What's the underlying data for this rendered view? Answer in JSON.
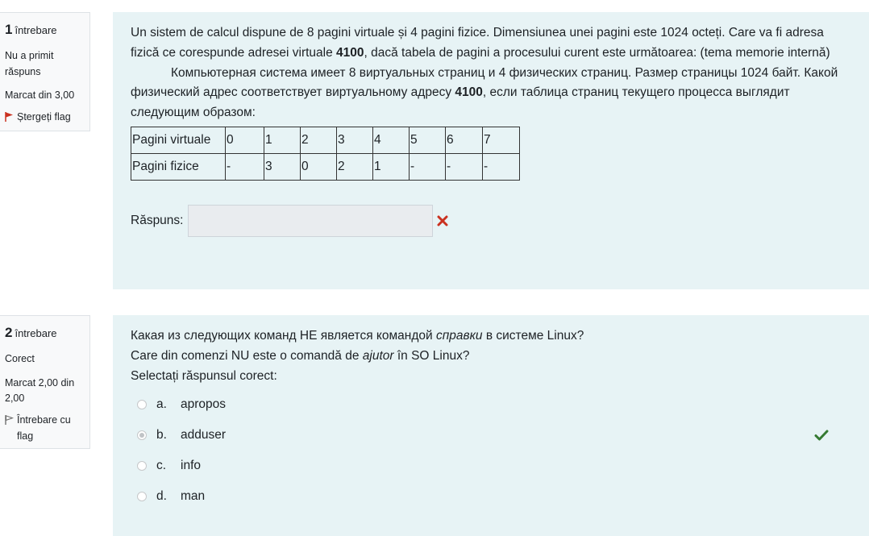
{
  "question1": {
    "number": "1",
    "word": "întrebare",
    "state": "Nu a primit răspuns",
    "grade": "Marcat din 3,00",
    "flag_label": "Ștergeți flag",
    "text_ro_part1": "Un sistem de calcul dispune de 8 pagini virtuale și 4 pagini fizice. Dimensiunea unei pagini este 1024 octeți. Care va fi adresa fizică ce corespunde adresei virtuale ",
    "address": "4100",
    "text_ro_part2": ",  dacă tabela de pagini a procesului curent este următoarea:      (tema memorie internă)",
    "text_ru_part1": "Компьютерная система имеет 8 виртуальных страниц и 4 физических страниц. Размер страницы 1024 байт. Какой физический адрес соответствует виртуальному адресу ",
    "text_ru_part2": ", если таблица страниц текущего процесса выглядит следующим образом:",
    "table": {
      "rows": [
        [
          "Pagini virtuale",
          "0",
          "1",
          "2",
          "3",
          "4",
          "5",
          "6",
          "7"
        ],
        [
          "Pagini fizice",
          "-",
          "3",
          "0",
          "2",
          "1",
          "-",
          "-",
          "-"
        ]
      ]
    },
    "answer_label": "Răspuns:",
    "answer_value": ""
  },
  "question2": {
    "number": "2",
    "word": "întrebare",
    "state": "Corect",
    "grade": "Marcat 2,00 din 2,00",
    "flag_label": "Întrebare cu flag",
    "text_ru_part1": "Какая из следующих команд НЕ является командой ",
    "text_ru_em": "справки",
    "text_ru_part2": " в системе Linux?",
    "text_ro_part1": "Care din comenzi NU este o comandă de ",
    "text_ro_em": "ajutor",
    "text_ro_part2": " în SO Linux?",
    "prompt": "Selectați răspunsul corect:",
    "options": [
      {
        "letter": "a.",
        "text": "apropos"
      },
      {
        "letter": "b.",
        "text": "adduser"
      },
      {
        "letter": "c.",
        "text": "info"
      },
      {
        "letter": "d.",
        "text": "man"
      }
    ],
    "selected": "b"
  },
  "colors": {
    "content_bg": "#e7f3f5",
    "info_bg": "#f8f9fa",
    "flag_red": "#ca3120",
    "wrong_red": "#ca3120",
    "correct_green": "#357a32"
  }
}
